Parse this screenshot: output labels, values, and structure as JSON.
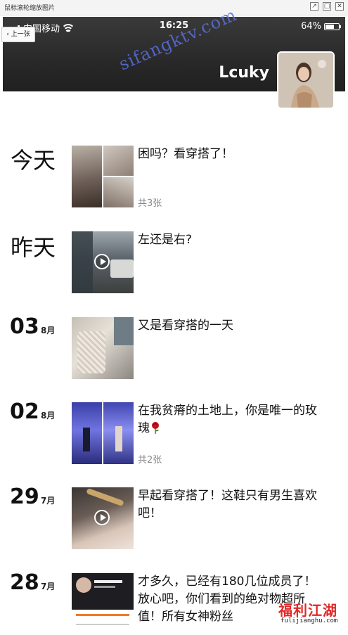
{
  "viewer": {
    "title": "鼠标滚轮缩放图片",
    "btn_restore": "↗",
    "btn_max": "□",
    "btn_close": "✕"
  },
  "status": {
    "carrier": "中国移动",
    "time": "16:25",
    "battery": "64%",
    "battery_level": 0.64
  },
  "header": {
    "prev_label": "上一张",
    "username": "Lcuky",
    "watermark": "sifangktv.com"
  },
  "posts": [
    {
      "date": "今天",
      "caption": "困吗？看穿搭了！",
      "count": "共3张",
      "media": "grid-4"
    },
    {
      "date": "昨天",
      "caption": "左还是右?",
      "media": "video"
    },
    {
      "day": "03",
      "month": "8月",
      "caption": "又是看穿搭的一天",
      "media": "photo"
    },
    {
      "day": "02",
      "month": "8月",
      "caption": "在我贫瘠的土地上，你是唯一的玫瑰",
      "count": "共2张",
      "media": "grid-2"
    },
    {
      "day": "29",
      "month": "7月",
      "caption": "早起看穿搭了！这鞋只有男生喜欢吧！",
      "media": "video"
    },
    {
      "day": "28",
      "month": "7月",
      "caption": "才多久，已经有180几位成员了！放心吧，你们看到的绝对物超所值！所有女神粉丝",
      "media": "screenshot"
    }
  ],
  "corner_logo": {
    "main": "福利江湖",
    "sub": "fulijianghu.com"
  },
  "colors": {
    "header_bg": "#262626",
    "watermark": "#5a6edc",
    "logo": "#e02828",
    "count_text": "#888888"
  }
}
